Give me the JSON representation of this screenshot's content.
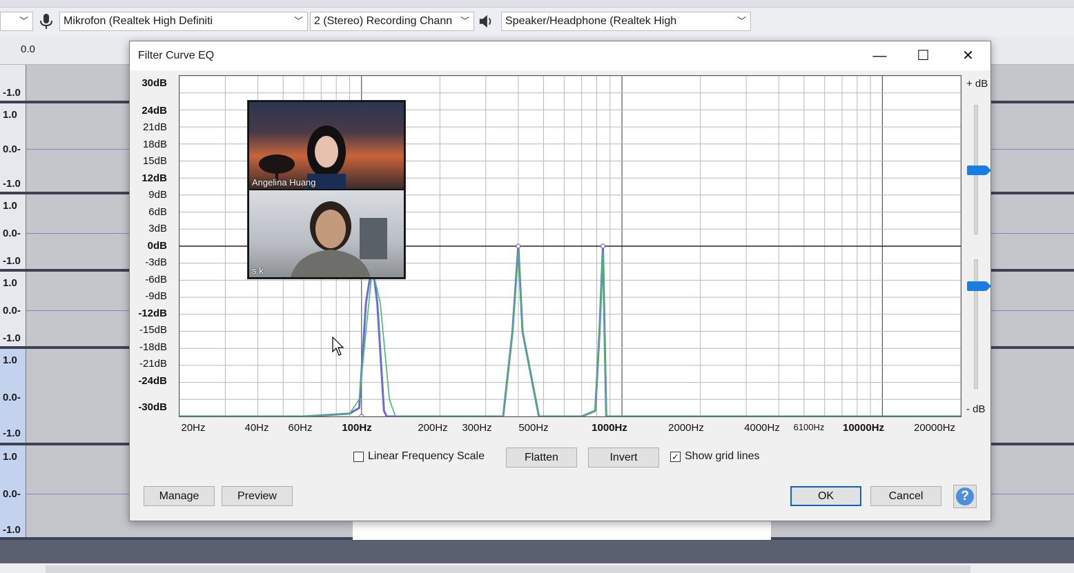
{
  "device_toolbar": {
    "host_value": "",
    "mic_device": "Mikrofon (Realtek High Definiti",
    "channels": "2 (Stereo) Recording Chann",
    "speaker_device": "Speaker/Headphone (Realtek High"
  },
  "timeline": {
    "start_label": "0.0"
  },
  "tracks": [
    {
      "scale": [
        "-1.0"
      ]
    },
    {
      "scale": [
        "1.0",
        "0.0-",
        "-1.0"
      ]
    },
    {
      "scale": [
        "1.0",
        "0.0-",
        "-1.0"
      ]
    },
    {
      "scale": [
        "1.0",
        "0.0-",
        "-1.0"
      ]
    },
    {
      "scale": [
        "1.0",
        "0.0-",
        "-1.0"
      ]
    },
    {
      "scale": [
        "1.0",
        "0.0-",
        "-1.0"
      ]
    }
  ],
  "dialog": {
    "title": "Filter Curve EQ",
    "window_buttons": {
      "minimize": "—",
      "maximize": "☐",
      "close": "✕"
    },
    "db_labels": [
      "30dB",
      "24dB",
      "21dB",
      "18dB",
      "15dB",
      "12dB",
      "9dB",
      "6dB",
      "3dB",
      "0dB",
      "-3dB",
      "-6dB",
      "-9dB",
      "-12dB",
      "-15dB",
      "-18dB",
      "-21dB",
      "-24dB",
      "-30dB"
    ],
    "hz_labels": [
      "20Hz",
      "40Hz",
      "60Hz",
      "100Hz",
      "200Hz",
      "300Hz",
      "500Hz",
      "1000Hz",
      "2000Hz",
      "4000Hz",
      "6100Hz",
      "10000Hz",
      "20000Hz"
    ],
    "plus_db": "+ dB",
    "minus_db": "- dB",
    "options": {
      "linear_frequency_scale": {
        "label": "Linear Frequency Scale",
        "checked": false
      },
      "flatten": "Flatten",
      "invert": "Invert",
      "show_grid_lines": {
        "label": "Show grid lines",
        "checked": true
      }
    },
    "buttons": {
      "manage": "Manage",
      "preview": "Preview",
      "ok": "OK",
      "cancel": "Cancel",
      "help": "?"
    }
  },
  "video_call": {
    "participants": [
      {
        "name": "Angelina Huang"
      },
      {
        "name": "s k"
      }
    ]
  },
  "chart_data": {
    "type": "line",
    "x_scale": "log",
    "xlim": [
      20,
      20000
    ],
    "ylim": [
      -30,
      30
    ],
    "grid": true,
    "series": [
      {
        "color": "#6b6bd6",
        "x": [
          20,
          60,
          90,
          98,
          104,
          110,
          115,
          122,
          125,
          200,
          350,
          380,
          400,
          415,
          480,
          700,
          790,
          820,
          845,
          870,
          20000
        ],
        "y": [
          -30,
          -30,
          -29.5,
          -28.5,
          -10,
          -3,
          -10,
          -29,
          -30,
          -30,
          -30,
          -15,
          0,
          -15,
          -30,
          -30,
          -29,
          -15,
          0,
          -30,
          -30
        ]
      },
      {
        "color": "#3fbf6a",
        "x": [
          20,
          60,
          90,
          98,
          104,
          110,
          118,
          128,
          135,
          200,
          350,
          380,
          400,
          415,
          480,
          700,
          790,
          820,
          845,
          870,
          20000
        ],
        "y": [
          -30,
          -30,
          -29.5,
          -27,
          -15,
          -4,
          -10,
          -27,
          -30,
          -30,
          -30,
          -15,
          -1,
          -15,
          -30,
          -30,
          -29,
          -15,
          -1,
          -30,
          -30
        ]
      }
    ],
    "control_points": [
      {
        "x": 100,
        "y": -30
      },
      {
        "x": 400,
        "y": 0
      },
      {
        "x": 845,
        "y": 0
      }
    ],
    "curve_colors": {
      "eq_curve": "#6b6bd6",
      "response_curve": "#3fbf6a"
    }
  },
  "colors": {
    "accent": "#1a7ee0",
    "help_button": "#4f8edc"
  }
}
